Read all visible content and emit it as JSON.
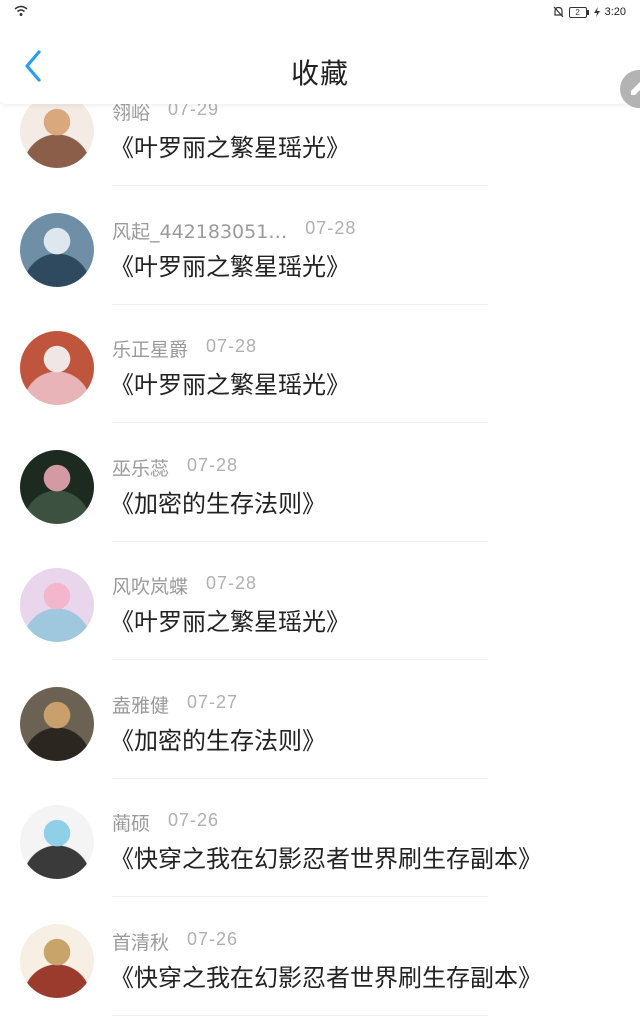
{
  "status_bar": {
    "time": "3:20",
    "battery": "2"
  },
  "header": {
    "title": "收藏"
  },
  "items": [
    {
      "user": "翎峪",
      "date": "07-29",
      "book": "《叶罗丽之繁星瑶光》",
      "avatar_colors": [
        "#f4ece4",
        "#d9a87c",
        "#8b5e4a"
      ]
    },
    {
      "user": "风起_442183051…",
      "date": "07-28",
      "book": "《叶罗丽之繁星瑶光》",
      "avatar_colors": [
        "#6f8fa6",
        "#dfe7ee",
        "#2f4a5f"
      ]
    },
    {
      "user": "乐正星爵",
      "date": "07-28",
      "book": "《叶罗丽之繁星瑶光》",
      "avatar_colors": [
        "#c0553e",
        "#f0e6e6",
        "#e8b4b8"
      ]
    },
    {
      "user": "巫乐蕊",
      "date": "07-28",
      "book": "《加密的生存法则》",
      "avatar_colors": [
        "#1d2a1f",
        "#d49aa4",
        "#3c5140"
      ]
    },
    {
      "user": "风吹岚蝶",
      "date": "07-28",
      "book": "《叶罗丽之繁星瑶光》",
      "avatar_colors": [
        "#e9d6ec",
        "#f3b6cc",
        "#9fc7de"
      ]
    },
    {
      "user": "盍雅健",
      "date": "07-27",
      "book": "《加密的生存法则》",
      "avatar_colors": [
        "#6c6254",
        "#c9a06b",
        "#2b2620"
      ]
    },
    {
      "user": "蔺硕",
      "date": "07-26",
      "book": "《快穿之我在幻影忍者世界刷生存副本》",
      "avatar_colors": [
        "#f4f4f4",
        "#8fd0e8",
        "#3a3a3a"
      ]
    },
    {
      "user": "首清秋",
      "date": "07-26",
      "book": "《快穿之我在幻影忍者世界刷生存副本》",
      "avatar_colors": [
        "#f7efe3",
        "#c9a46a",
        "#9b3b2e"
      ]
    }
  ],
  "colors": {
    "accent": "#2b9cf0",
    "title_text": "#222222",
    "meta_text": "#9a9a9a"
  }
}
